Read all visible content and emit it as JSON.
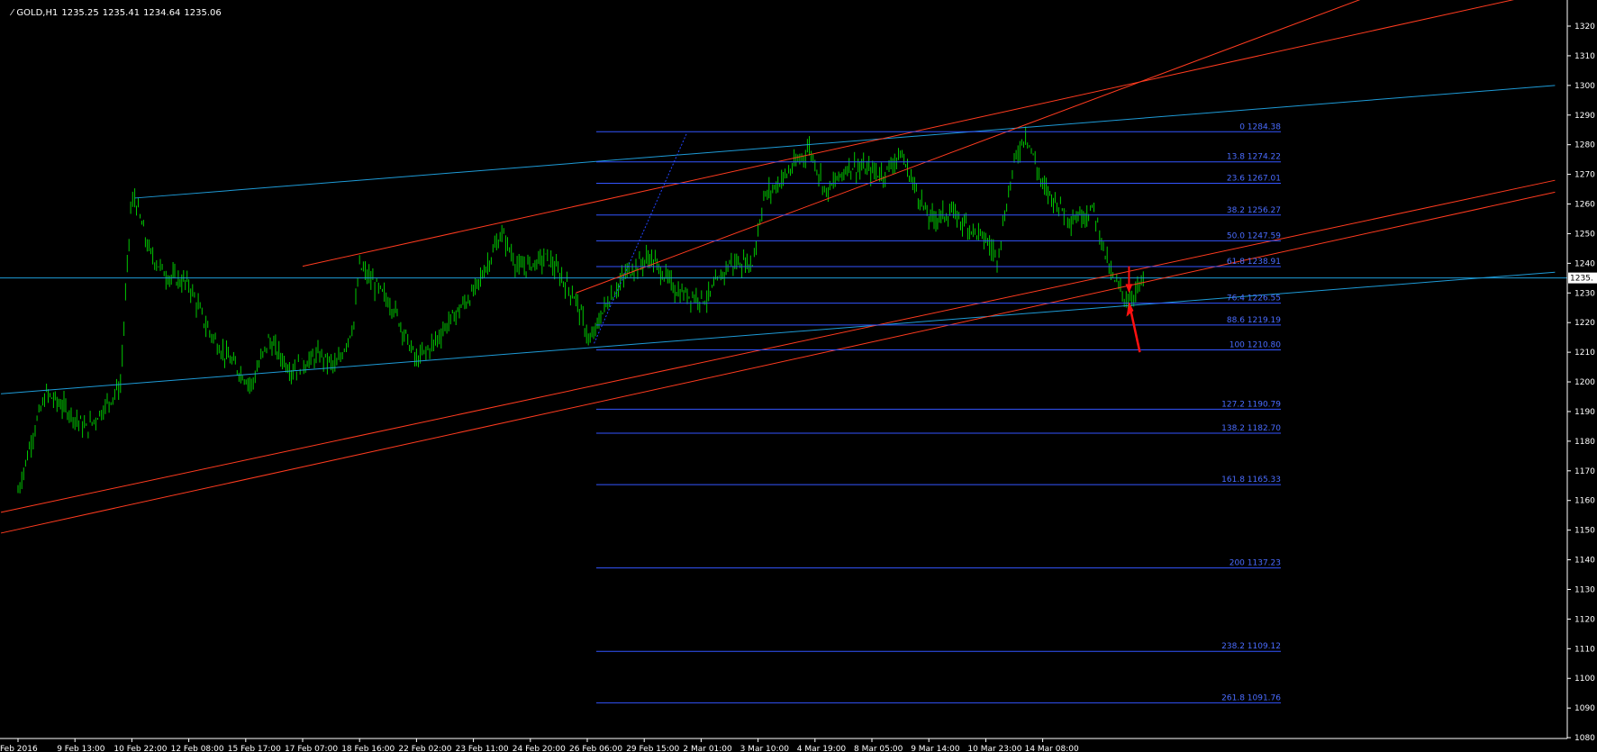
{
  "header": {
    "symbol": "GOLD,H1",
    "open": "1235.25",
    "high": "1235.41",
    "low": "1234.64",
    "close": "1235.06"
  },
  "colors": {
    "background": "#000000",
    "candles": "#00c800",
    "channel_blue": "#1e9bd7",
    "trend_red": "#ff3b1f",
    "fib": "#3355ff",
    "arrow": "#ff1010",
    "axis": "#ffffff"
  },
  "current_price_label": "1235.",
  "chart_data": {
    "type": "line",
    "title": "GOLD,H1",
    "ylim": [
      1078.5,
      1331.5
    ],
    "y_ticks": [
      1080,
      1090,
      1100,
      1110,
      1120,
      1130,
      1140,
      1150,
      1160,
      1170,
      1180,
      1190,
      1200,
      1210,
      1220,
      1230,
      1240,
      1250,
      1260,
      1270,
      1280,
      1290,
      1300,
      1310,
      1320
    ],
    "x_tick_labels": [
      "Feb 2016",
      "9 Feb 13:00",
      "10 Feb 22:00",
      "12 Feb 08:00",
      "15 Feb 17:00",
      "17 Feb 07:00",
      "18 Feb 16:00",
      "22 Feb 02:00",
      "23 Feb 11:00",
      "24 Feb 20:00",
      "26 Feb 06:00",
      "29 Feb 15:00",
      "2 Mar 01:00",
      "3 Mar 10:00",
      "4 Mar 19:00",
      "8 Mar 05:00",
      "9 Mar 14:00",
      "10 Mar 23:00",
      "14 Mar 08:00"
    ],
    "price_series": {
      "name": "GOLD",
      "x": [
        "Feb 2016",
        "9 Feb 13:00",
        "10 Feb 22:00",
        "12 Feb 08:00",
        "15 Feb 17:00",
        "17 Feb 07:00",
        "18 Feb 16:00",
        "22 Feb 02:00",
        "23 Feb 11:00",
        "24 Feb 20:00",
        "26 Feb 06:00",
        "29 Feb 15:00",
        "2 Mar 01:00",
        "3 Mar 10:00",
        "4 Mar 19:00",
        "8 Mar 05:00",
        "9 Mar 14:00",
        "10 Mar 23:00",
        "14 Mar 08:00"
      ],
      "path": [
        [
          0,
          1163
        ],
        [
          0.3,
          1185
        ],
        [
          0.5,
          1196
        ],
        [
          0.9,
          1190
        ],
        [
          1.2,
          1184
        ],
        [
          1.5,
          1191
        ],
        [
          1.8,
          1199
        ],
        [
          1.98,
          1258
        ],
        [
          2.05,
          1262
        ],
        [
          2.3,
          1244
        ],
        [
          2.6,
          1236
        ],
        [
          3.0,
          1233
        ],
        [
          3.3,
          1219
        ],
        [
          3.6,
          1210
        ],
        [
          4.1,
          1199
        ],
        [
          4.4,
          1214
        ],
        [
          4.8,
          1204
        ],
        [
          5.3,
          1209
        ],
        [
          5.6,
          1205
        ],
        [
          5.9,
          1220
        ],
        [
          6.0,
          1239
        ],
        [
          6.3,
          1232
        ],
        [
          6.6,
          1225
        ],
        [
          7.0,
          1207
        ],
        [
          7.3,
          1213
        ],
        [
          7.6,
          1221
        ],
        [
          8.0,
          1230
        ],
        [
          8.5,
          1250
        ],
        [
          8.8,
          1238
        ],
        [
          9.3,
          1242
        ],
        [
          9.8,
          1228
        ],
        [
          10.05,
          1213
        ],
        [
          10.3,
          1225
        ],
        [
          10.7,
          1237
        ],
        [
          11.1,
          1242
        ],
        [
          11.6,
          1230
        ],
        [
          12.1,
          1228
        ],
        [
          12.5,
          1240
        ],
        [
          12.9,
          1240
        ],
        [
          13.1,
          1262
        ],
        [
          13.6,
          1272
        ],
        [
          13.9,
          1279
        ],
        [
          14.2,
          1264
        ],
        [
          14.6,
          1273
        ],
        [
          15.2,
          1270
        ],
        [
          15.5,
          1277
        ],
        [
          16.0,
          1255
        ],
        [
          16.4,
          1257
        ],
        [
          17.0,
          1248
        ],
        [
          17.2,
          1242
        ],
        [
          17.5,
          1274
        ],
        [
          17.7,
          1284
        ],
        [
          18.0,
          1266
        ],
        [
          18.5,
          1255
        ],
        [
          18.9,
          1258
        ],
        [
          19.2,
          1236
        ],
        [
          19.5,
          1227
        ],
        [
          19.8,
          1235
        ]
      ]
    },
    "fibonacci_levels": [
      {
        "level": "0",
        "value": 1284.38
      },
      {
        "level": "13.8",
        "value": 1274.22
      },
      {
        "level": "23.6",
        "value": 1267.01
      },
      {
        "level": "38.2",
        "value": 1256.27
      },
      {
        "level": "50.0",
        "value": 1247.59
      },
      {
        "level": "61.8",
        "value": 1238.91
      },
      {
        "level": "76.4",
        "value": 1226.55
      },
      {
        "level": "88.6",
        "value": 1219.19
      },
      {
        "level": "100",
        "value": 1210.8
      },
      {
        "level": "127.2",
        "value": 1190.79
      },
      {
        "level": "138.2",
        "value": 1182.7
      },
      {
        "level": "161.8",
        "value": 1165.33
      },
      {
        "level": "200",
        "value": 1137.23
      },
      {
        "level": "238.2",
        "value": 1109.12
      },
      {
        "level": "261.8",
        "value": 1091.76
      }
    ],
    "horizontal_price_line": 1235.06
  }
}
